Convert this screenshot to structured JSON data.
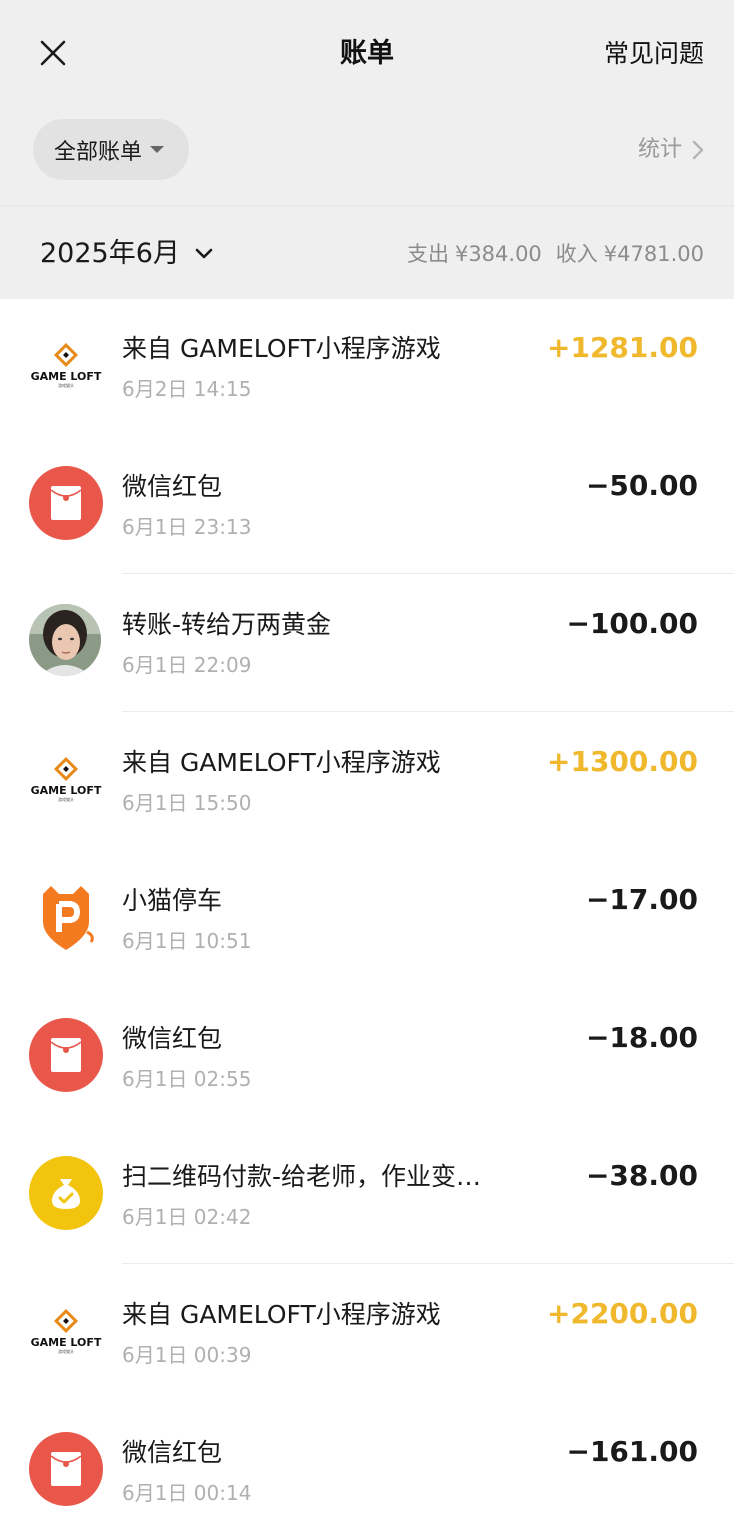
{
  "header": {
    "title": "账单",
    "faq_label": "常见问题",
    "filter_label": "全部账单",
    "stats_label": "统计"
  },
  "month_bar": {
    "month": "2025年6月",
    "expense_label": "支出",
    "expense_value": "¥384.00",
    "income_label": "收入",
    "income_value": "¥4781.00"
  },
  "transactions": [
    {
      "icon": "gameloft-logo",
      "title": "来自 GAMELOFT小程序游戏",
      "time": "6月2日 14:15",
      "amount": "+1281.00",
      "type": "income"
    },
    {
      "icon": "red-packet-icon",
      "title": "微信红包",
      "time": "6月1日 23:13",
      "amount": "−50.00",
      "type": "expense"
    },
    {
      "icon": "avatar",
      "title": "转账-转给万两黄金",
      "time": "6月1日 22:09",
      "amount": "−100.00",
      "type": "expense"
    },
    {
      "icon": "gameloft-logo",
      "title": "来自 GAMELOFT小程序游戏",
      "time": "6月1日 15:50",
      "amount": "+1300.00",
      "type": "income"
    },
    {
      "icon": "parking-icon",
      "title": "小猫停车",
      "time": "6月1日 10:51",
      "amount": "−17.00",
      "type": "expense"
    },
    {
      "icon": "red-packet-icon",
      "title": "微信红包",
      "time": "6月1日 02:55",
      "amount": "−18.00",
      "type": "expense"
    },
    {
      "icon": "money-bag-icon",
      "title": "扫二维码付款-给老师，作业变…",
      "time": "6月1日 02:42",
      "amount": "−38.00",
      "type": "expense"
    },
    {
      "icon": "gameloft-logo",
      "title": "来自 GAMELOFT小程序游戏",
      "time": "6月1日 00:39",
      "amount": "+2200.00",
      "type": "income"
    },
    {
      "icon": "red-packet-icon",
      "title": "微信红包",
      "time": "6月1日 00:14",
      "amount": "−161.00",
      "type": "expense"
    }
  ],
  "logo_text": {
    "brand": "GAME LOFT",
    "sub": "游戏猫头"
  },
  "colors": {
    "income": "#f0b92d",
    "red_packet": "#e9574b",
    "money_bag": "#f3c40d",
    "parking": "#f47a1f"
  }
}
